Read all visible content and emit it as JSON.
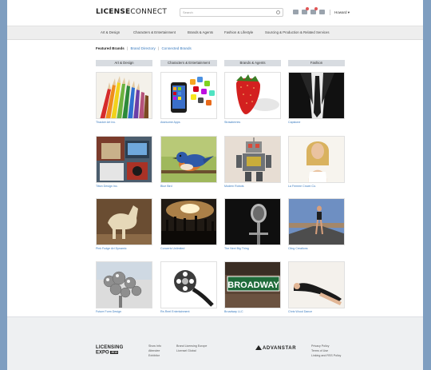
{
  "header": {
    "logo_bold": "LICENSE",
    "logo_light": "CONNECT",
    "search_placeholder": "Search",
    "user": "Howard ▾",
    "icons": [
      "grid-icon",
      "mail-icon",
      "people-icon",
      "bell-icon"
    ]
  },
  "nav": {
    "items": [
      "Art & Design",
      "Characters & Entertainment",
      "Brands & Agents",
      "Fashion & Lifestyle",
      "Sourcing & Production & Related Services"
    ]
  },
  "subnav": {
    "featured": "Featured Brands",
    "sep": "|",
    "directory": "Brand Directory",
    "connected": "Connected Brands"
  },
  "columns": [
    "Art & Design",
    "Characters & Entertainment",
    "Brands & Agents",
    "Fashion"
  ],
  "tiles": [
    {
      "caption": "Thacker Art Inc.",
      "image": "colored-pencils"
    },
    {
      "caption": "Awesome Apps",
      "image": "smartphone-app-icons"
    },
    {
      "caption": "Strawberries",
      "image": "strawberry"
    },
    {
      "caption": "Capstone",
      "image": "suit-and-tie"
    },
    {
      "caption": "Tilton Design Inc.",
      "image": "desk-clutter"
    },
    {
      "caption": "Blue Bird",
      "image": "bluebird"
    },
    {
      "caption": "Modern Robots",
      "image": "toy-robot"
    },
    {
      "caption": "La Femme Crown Co.",
      "image": "woman-portrait"
    },
    {
      "caption": "Pink Fudge Art Dynamic",
      "image": "horse-sculpture"
    },
    {
      "caption": "Concerts Unlimited",
      "image": "concert-crowd"
    },
    {
      "caption": "The Next Big Thing",
      "image": "microphone"
    },
    {
      "caption": "Cling Creations",
      "image": "woman-road"
    },
    {
      "caption": "Future Form Design",
      "image": "mirror-spheres"
    },
    {
      "caption": "Re-Reel Entertainment",
      "image": "film-reel"
    },
    {
      "caption": "Broadway LLC",
      "image": "broadway-sign"
    },
    {
      "caption": "Chris Wood Dance",
      "image": "woman-lying"
    }
  ],
  "broadway_sign": "BROADWAY",
  "footer": {
    "expo_l1": "LICENSING",
    "expo_l2": "EXPO",
    "expo_year": "2013",
    "col1": [
      "Show Info",
      "Attendee",
      "Exhibitor"
    ],
    "col2": [
      "Brand Licensing Europe",
      "Licensel Global"
    ],
    "advanstar": "ADVANSTAR",
    "col3": [
      "Privacy Policy",
      "Terms of Use",
      "Linking and RSS Policy"
    ]
  },
  "colors": {
    "background": "#7f9ec0",
    "link": "#3a7bbf",
    "nav_bg": "#eeeeee",
    "column_header_bg": "#d8dce1",
    "footer_bg": "#eef0f2"
  }
}
